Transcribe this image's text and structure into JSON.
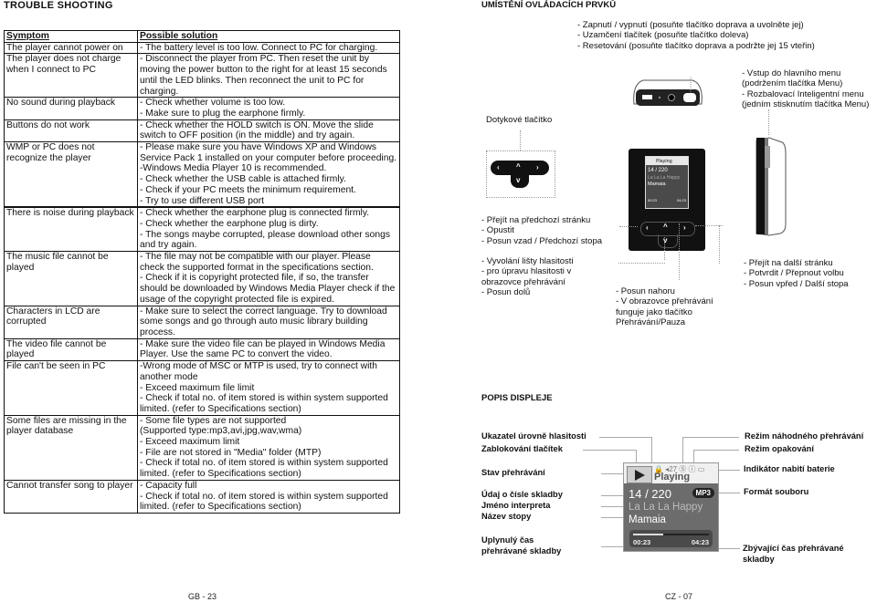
{
  "left_page": {
    "title": "TROUBLE SHOOTING",
    "table": {
      "headers": [
        "Symptom",
        "Possible solution"
      ],
      "rows": [
        {
          "symptom": "The player cannot power on",
          "solution": [
            "- The battery level is too low. Connect to PC for charging."
          ]
        },
        {
          "symptom": "The player does not charge when I connect to PC",
          "solution": [
            "- Disconnect the player from PC. Then reset the unit by moving the power button to the right for at least 15 seconds until the LED blinks. Then reconnect the unit to PC for charging."
          ]
        },
        {
          "symptom": "No sound during playback",
          "solution": [
            "- Check whether volume is too low.",
            "- Make sure to plug the earphone firmly."
          ]
        },
        {
          "symptom": "Buttons do not work",
          "solution": [
            "- Check whether the HOLD switch is ON. Move the slide switch to OFF position (in the middle) and try again."
          ]
        },
        {
          "symptom": "WMP or PC does not recognize the player",
          "solution": [
            "- Please make sure you have Windows XP and Windows Service Pack 1 installed on your computer before proceeding.",
            "-Windows Media Player 10 is recommended.",
            "- Check whether the USB cable is attached firmly.",
            "- Check if your PC meets the minimum requirement.",
            "- Try to use different USB port"
          ]
        },
        {
          "symptom": "There is noise during playback",
          "solution": [
            "- Check whether the earphone plug is connected firmly.",
            "- Check whether the earphone plug is dirty.",
            "- The songs maybe corrupted, please download other songs and try again."
          ]
        },
        {
          "symptom": "The music file cannot be played",
          "solution": [
            "- The file may not be compatible with our player. Please check the supported format in the specifications section.",
            "- Check if it is copyright protected file, if so, the transfer should be downloaded by Windows Media Player check if the usage of the copyright protected file is expired."
          ]
        },
        {
          "symptom": "Characters in LCD are corrupted",
          "solution": [
            "- Make sure to select the correct language. Try to download some songs and go through auto music library building process."
          ]
        },
        {
          "symptom": "The video file cannot be played",
          "solution": [
            "- Make sure the video file can be played in Windows Media Player. Use the same PC to convert the video."
          ]
        },
        {
          "symptom": "File can't be seen in PC",
          "solution": [
            "-Wrong mode of MSC or MTP is used, try to connect with another mode",
            "- Exceed maximum file limit",
            "- Check if total no. of item stored is within system supported limited. (refer to Specifications section)"
          ]
        },
        {
          "symptom": "Some files are missing in the player database",
          "solution": [
            "- Some file types are not supported",
            "(Supported type:mp3,avi,jpg,wav,wma)",
            "- Exceed maximum limit",
            "- File are not stored in \"Media\" folder (MTP)",
            "- Check if total no. of item stored is within system supported limited. (refer to Specifications section)"
          ]
        },
        {
          "symptom": "Cannot transfer song to player",
          "solution": [
            "- Capacity full",
            "- Check if total no. of item stored is within system supported limited. (refer to Specifications section)"
          ]
        }
      ]
    },
    "page_number": "GB - 23"
  },
  "right_page": {
    "controls_title": "UMÍSTĚNÍ OVLÁDACÍCH PRVKŮ",
    "power_notes": [
      "- Zapnutí / vypnutí (posuňte tlačítko doprava a uvolněte jej)",
      "- Uzamčení tlačítek (posuňte tlačítko doleva)",
      "- Resetování (posuňte tlačítko doprava a podržte jej 15 vteřin)"
    ],
    "menu_notes": [
      "- Vstup do hlavního menu",
      "(podržením tlačítka Menu)",
      "- Rozbalovací Inteligentní menu",
      "(jedním stisknutím tlačítka Menu)"
    ],
    "touch_button_label": "Dotykové tlačítko",
    "left_key_notes": [
      "- Přejít na předchozí stránku",
      "- Opustit",
      "- Posun vzad / Předchozí stopa"
    ],
    "down_key_notes": [
      "- Vyvolání lišty hlasitosti",
      "- pro úpravu hlasitosti v",
      "obrazovce přehrávání",
      "- Posun dolů"
    ],
    "up_key_notes": [
      "- Posun nahoru",
      "- V obrazovce přehrávání",
      "funguje jako tlačítko",
      "Přehrávání/Pauza"
    ],
    "right_key_notes": [
      "- Přejít na další stránku",
      "- Potvrdit / Přepnout volbu",
      "- Posun vpřed / Další stopa"
    ],
    "display_title": "POPIS DISPLEJE",
    "display_labels_left": {
      "volume": "Ukazatel úrovně hlasitosti",
      "keylock": "Zablokování tlačítek",
      "play_state": "Stav přehrávání",
      "track_number": "Údaj o čísle skladby",
      "artist": "Jméno interpreta",
      "track_name": "Název stopy",
      "elapsed_1": "Uplynulý čas",
      "elapsed_2": "přehrávané skladby"
    },
    "display_labels_right": {
      "shuffle": "Režim náhodného přehrávání",
      "repeat": "Režim opakování",
      "battery": "Indikátor nabití baterie",
      "format": "Formát souboru",
      "remaining_1": "Zbývající čas přehrávané",
      "remaining_2": "skladby"
    },
    "lcd": {
      "status_icons": "🔒 ◂27 Ⓢ ⓘ ▭",
      "playing": "Playing",
      "track": "14 / 220",
      "format": "MP3",
      "artist": "La La La Happy",
      "title": "Mamaia",
      "elapsed": "00:23",
      "remaining": "04:23",
      "progress_fraction": 0.4
    },
    "mini_lcd": {
      "playing": "Playing",
      "track": "14 / 220",
      "artist": "La La La Happy",
      "title": "Mamaia",
      "elapsed": "00:23",
      "remaining": "04:23"
    },
    "page_number": "CZ - 07"
  }
}
